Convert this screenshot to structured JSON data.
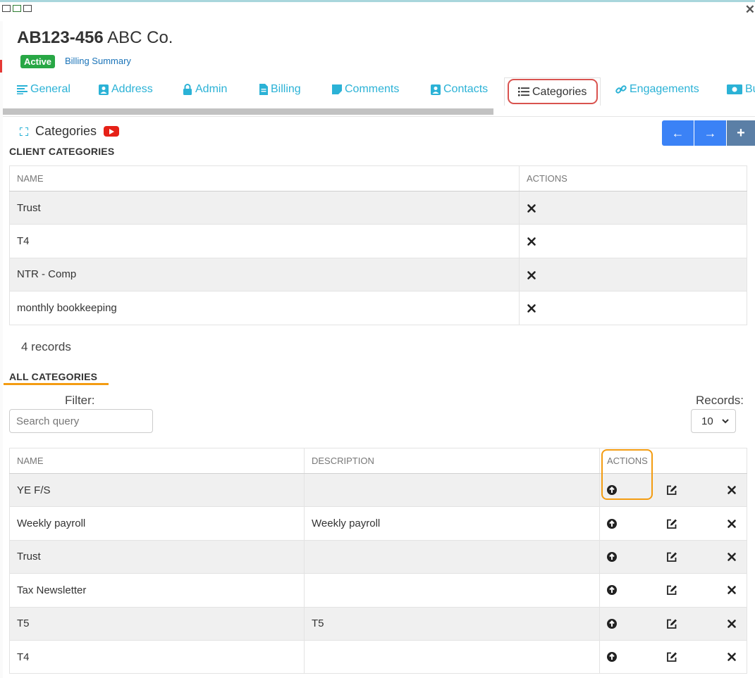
{
  "header": {
    "code": "AB123-456",
    "name": "ABC Co.",
    "status_badge": "Active",
    "billing_summary_link": "Billing Summary"
  },
  "tabs": [
    {
      "label": "General",
      "icon": "lines-icon"
    },
    {
      "label": "Address",
      "icon": "contact-card-icon"
    },
    {
      "label": "Admin",
      "icon": "lock-icon"
    },
    {
      "label": "Billing",
      "icon": "document-icon"
    },
    {
      "label": "Comments",
      "icon": "note-icon"
    },
    {
      "label": "Contacts",
      "icon": "contact-card-icon"
    },
    {
      "label": "Categories",
      "icon": "list-icon",
      "active": true
    },
    {
      "label": "Engagements",
      "icon": "link-icon"
    },
    {
      "label": "Bu",
      "icon": "money-icon"
    }
  ],
  "section": {
    "title": "Categories",
    "nav": {
      "prev": "←",
      "next": "→",
      "add": "+"
    }
  },
  "client_categories": {
    "heading": "CLIENT CATEGORIES",
    "columns": [
      "NAME",
      "ACTIONS"
    ],
    "rows": [
      "Trust",
      "T4",
      "NTR - Comp",
      "monthly bookkeeping"
    ],
    "record_count": "4 records"
  },
  "all_categories": {
    "heading": "ALL CATEGORIES",
    "filter_label": "Filter:",
    "search_placeholder": "Search query",
    "records_label": "Records:",
    "records_per_page": "10",
    "columns": [
      "NAME",
      "DESCRIPTION",
      "ACTIONS"
    ],
    "rows": [
      {
        "name": "YE F/S",
        "description": ""
      },
      {
        "name": "Weekly payroll",
        "description": "Weekly payroll"
      },
      {
        "name": "Trust",
        "description": ""
      },
      {
        "name": "Tax Newsletter",
        "description": ""
      },
      {
        "name": "T5",
        "description": "T5"
      },
      {
        "name": "T4",
        "description": ""
      }
    ]
  },
  "colors": {
    "tab_accent": "#2bb2d6",
    "active_badge": "#28a745",
    "highlight_red": "#d9534f",
    "highlight_orange": "#f39c12",
    "nav_blue": "#3b82f6"
  }
}
